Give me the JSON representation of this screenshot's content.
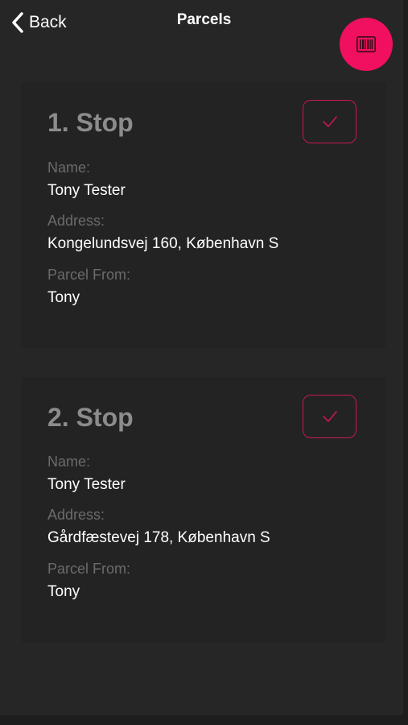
{
  "header": {
    "back_label": "Back",
    "title": "Parcels",
    "scan_icon": "barcode-icon",
    "back_icon": "chevron-left-icon"
  },
  "colors": {
    "accent": "#f0105f",
    "check_border": "#c8174f",
    "background": "#262626",
    "muted_text": "#8c8c8c",
    "label_text": "#6b6b6b"
  },
  "stops": [
    {
      "title": "1. Stop",
      "name_label": "Name:",
      "name": "Tony Tester",
      "address_label": "Address:",
      "address": "Kongelundsvej 160, København S",
      "from_label": "Parcel From:",
      "from": "Tony",
      "check_icon": "checkmark-icon"
    },
    {
      "title": "2. Stop",
      "name_label": "Name:",
      "name": "Tony Tester",
      "address_label": "Address:",
      "address": "Gårdfæstevej 178, København S",
      "from_label": "Parcel From:",
      "from": "Tony",
      "check_icon": "checkmark-icon"
    }
  ]
}
